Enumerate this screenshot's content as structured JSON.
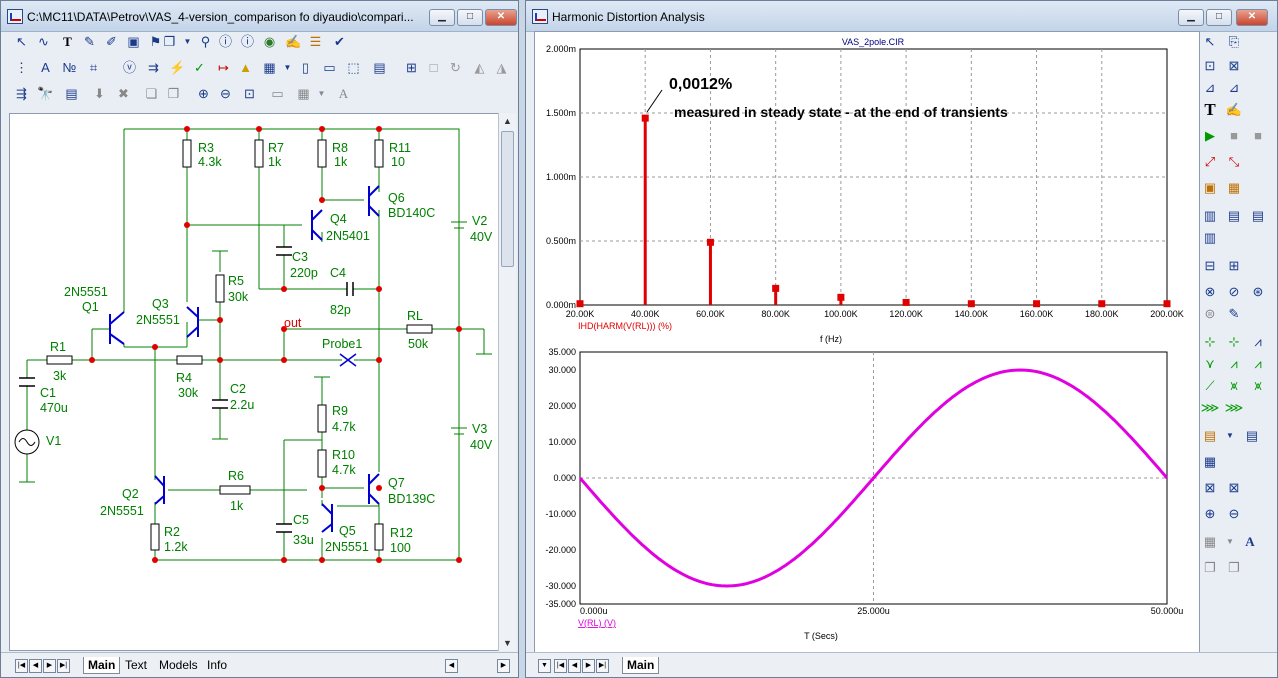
{
  "left_window": {
    "title": "C:\\MC11\\DATA\\Petrov\\VAS_4-version_comparison fo diyaudio\\compari...",
    "tabs": [
      "Main",
      "Text",
      "Models",
      "Info"
    ],
    "active_tab": "Main"
  },
  "right_window": {
    "title": "Harmonic Distortion Analysis",
    "tabs": [
      "Main"
    ],
    "active_tab": "Main"
  },
  "schematic": {
    "components": {
      "r3": {
        "name": "R3",
        "value": "4.3k"
      },
      "r7": {
        "name": "R7",
        "value": "1k"
      },
      "r8": {
        "name": "R8",
        "value": "1k"
      },
      "r11": {
        "name": "R11",
        "value": "10"
      },
      "q6": {
        "name": "Q6",
        "value": "BD140C"
      },
      "q4": {
        "name": "Q4",
        "value": "2N5401"
      },
      "v2": {
        "name": "V2",
        "value": "40V"
      },
      "c3": {
        "name": "C3",
        "value": "220p"
      },
      "c4": {
        "name": "C4",
        "value": "82p"
      },
      "r5": {
        "name": "R5",
        "value": "30k"
      },
      "q1": {
        "name": "Q1",
        "value": "2N5551"
      },
      "q3": {
        "name": "Q3",
        "value": "2N5551"
      },
      "rl": {
        "name": "RL",
        "value": "50k"
      },
      "r1": {
        "name": "R1",
        "value": "3k"
      },
      "r4": {
        "name": "R4",
        "value": "30k"
      },
      "c1": {
        "name": "C1",
        "value": "470u"
      },
      "c2": {
        "name": "C2",
        "value": "2.2u"
      },
      "v1": {
        "name": "V1"
      },
      "r9": {
        "name": "R9",
        "value": "4.7k"
      },
      "r10": {
        "name": "R10",
        "value": "4.7k"
      },
      "v3": {
        "name": "V3",
        "value": "40V"
      },
      "r6": {
        "name": "R6",
        "value": "1k"
      },
      "q2": {
        "name": "Q2",
        "value": "2N5551"
      },
      "q7": {
        "name": "Q7",
        "value": "BD139C"
      },
      "c5": {
        "name": "C5",
        "value": "33u"
      },
      "q5": {
        "name": "Q5",
        "value": "2N5551"
      },
      "r2": {
        "name": "R2",
        "value": "1.2k"
      },
      "r12": {
        "name": "R12",
        "value": "100"
      }
    },
    "node_label": "out",
    "probe_label": "Probe1"
  },
  "chart_data": [
    {
      "type": "bar",
      "title": "VAS_2pole.CIR",
      "annotation": "0,0012%",
      "annotation2": "measured in steady state - at the end of transients",
      "xlabel": "f (Hz)",
      "series_label": "IHD(HARM(V(RL))) (%)",
      "series_color": "#e00000",
      "xlim": [
        20000,
        200000
      ],
      "ylim": [
        0,
        0.002
      ],
      "x_ticks": [
        "20.00K",
        "40.00K",
        "60.00K",
        "80.00K",
        "100.00K",
        "120.00K",
        "140.00K",
        "160.00K",
        "180.00K",
        "200.00K"
      ],
      "y_ticks": [
        "0.000m",
        "0.500m",
        "1.000m",
        "1.500m",
        "2.000m"
      ],
      "grid": true,
      "x": [
        20000,
        40000,
        60000,
        80000,
        100000,
        120000,
        140000,
        160000,
        180000,
        200000
      ],
      "values": [
        1e-05,
        0.00146,
        0.00049,
        0.00013,
        6e-05,
        2e-05,
        1e-05,
        1e-05,
        1e-05,
        1e-05
      ]
    },
    {
      "type": "line",
      "xlabel": "T (Secs)",
      "series_label": "V(RL) (V)",
      "series_color": "#e000e0",
      "xlim": [
        0,
        5e-05
      ],
      "ylim": [
        -35,
        35
      ],
      "x_ticks": [
        "0.000u",
        "25.000u",
        "50.000u"
      ],
      "y_ticks": [
        "-35.000",
        "-30.000",
        "-20.000",
        "-10.000",
        "0.000",
        "10.000",
        "20.000",
        "30.000",
        "35.000"
      ],
      "grid": true,
      "amplitude": 30,
      "frequency_hz": 20000,
      "phase": "negative sine"
    }
  ]
}
